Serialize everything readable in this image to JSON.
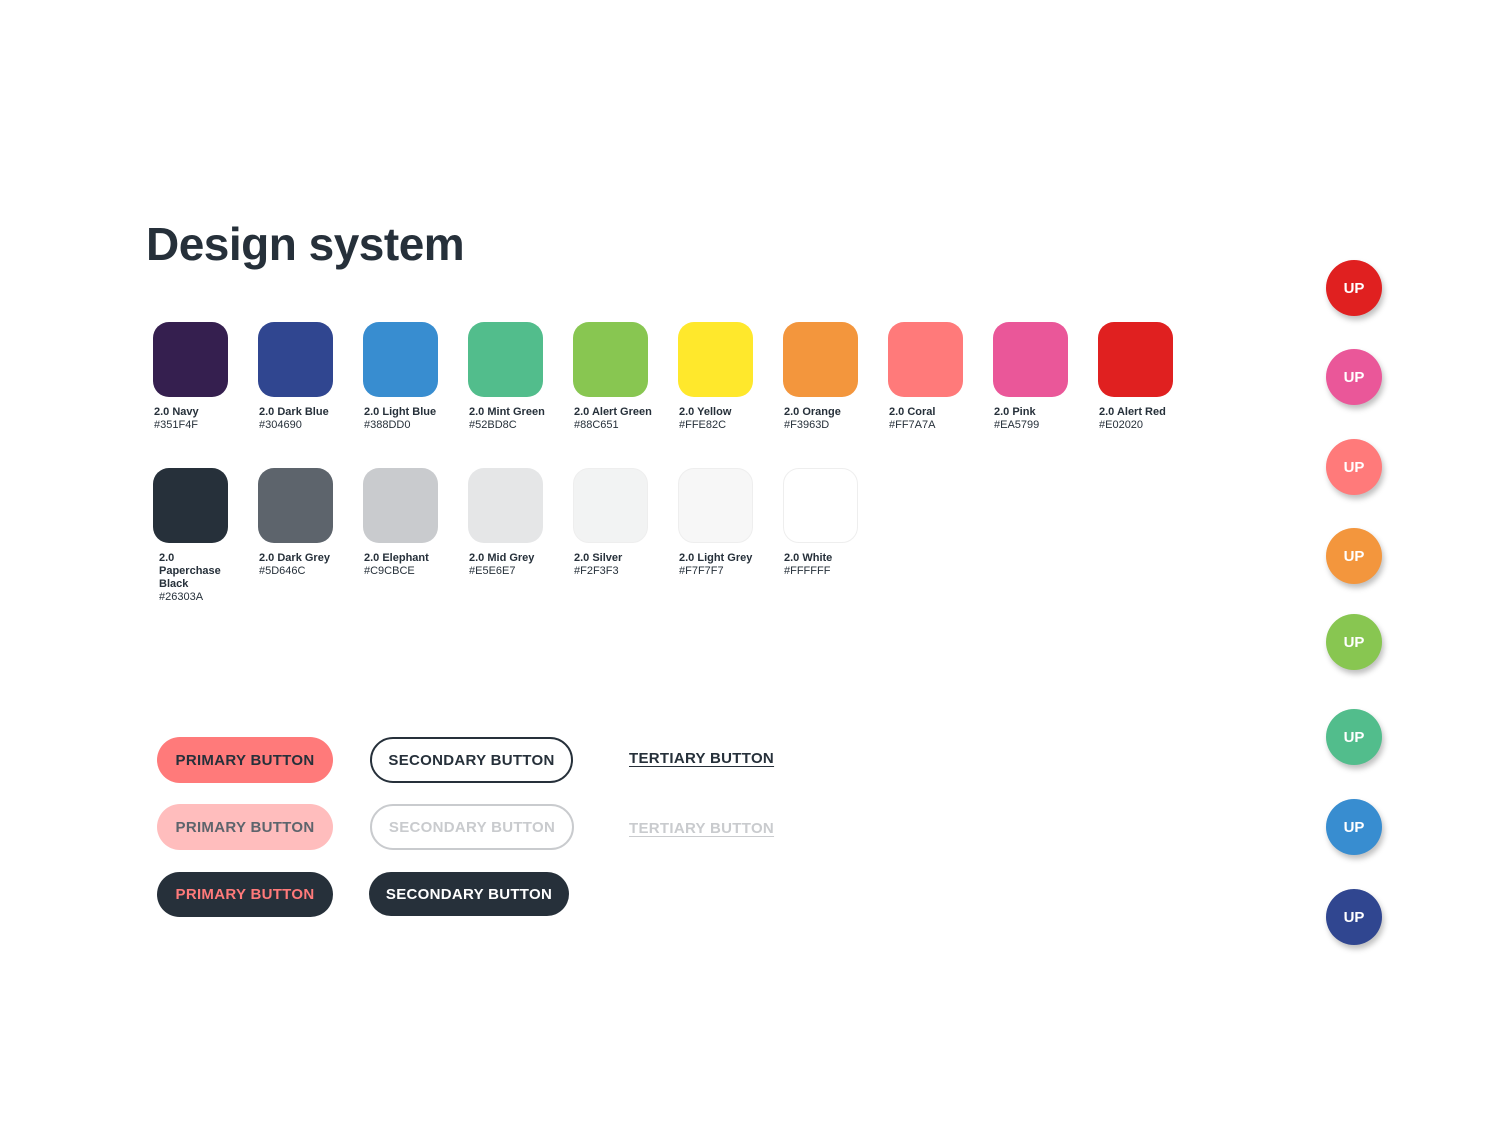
{
  "page": {
    "title": "Design system"
  },
  "colors_row1": [
    {
      "name": "2.0 Navy",
      "hex": "#351F4F"
    },
    {
      "name": "2.0 Dark Blue",
      "hex": "#304690"
    },
    {
      "name": "2.0 Light Blue",
      "hex": "#388DD0"
    },
    {
      "name": "2.0 Mint Green",
      "hex": "#52BD8C"
    },
    {
      "name": "2.0 Alert Green",
      "hex": "#88C651"
    },
    {
      "name": "2.0 Yellow",
      "hex": "#FFE82C"
    },
    {
      "name": "2.0 Orange",
      "hex": "#F3963D"
    },
    {
      "name": "2.0 Coral",
      "hex": "#FF7A7A"
    },
    {
      "name": "2.0 Pink",
      "hex": "#EA5799"
    },
    {
      "name": "2.0 Alert Red",
      "hex": "#E02020"
    }
  ],
  "colors_row2": [
    {
      "name": "2.0 Paperchase Black",
      "hex": "#26303A"
    },
    {
      "name": "2.0 Dark Grey",
      "hex": "#5D646C"
    },
    {
      "name": "2.0 Elephant",
      "hex": "#C9CBCE"
    },
    {
      "name": "2.0 Mid Grey",
      "hex": "#E5E6E7"
    },
    {
      "name": "2.0 Silver",
      "hex": "#F2F3F3"
    },
    {
      "name": "2.0 Light Grey",
      "hex": "#F7F7F7"
    },
    {
      "name": "2.0 White",
      "hex": "#FFFFFF"
    }
  ],
  "buttons": {
    "primary": "PRIMARY BUTTON",
    "primary_disabled": "PRIMARY BUTTON",
    "primary_dark": "PRIMARY BUTTON",
    "secondary": "SECONDARY BUTTON",
    "secondary_disabled": "SECONDARY BUTTON",
    "secondary_dark": "SECONDARY BUTTON",
    "tertiary": "TERTIARY BUTTON",
    "tertiary_disabled": "TERTIARY BUTTON"
  },
  "fabs": [
    {
      "label": "UP",
      "color": "#E02020"
    },
    {
      "label": "UP",
      "color": "#EA5799"
    },
    {
      "label": "UP",
      "color": "#FF7A7A"
    },
    {
      "label": "UP",
      "color": "#F3963D"
    },
    {
      "label": "UP",
      "color": "#88C651"
    },
    {
      "label": "UP",
      "color": "#52BD8C"
    },
    {
      "label": "UP",
      "color": "#388DD0"
    },
    {
      "label": "UP",
      "color": "#304690"
    }
  ]
}
